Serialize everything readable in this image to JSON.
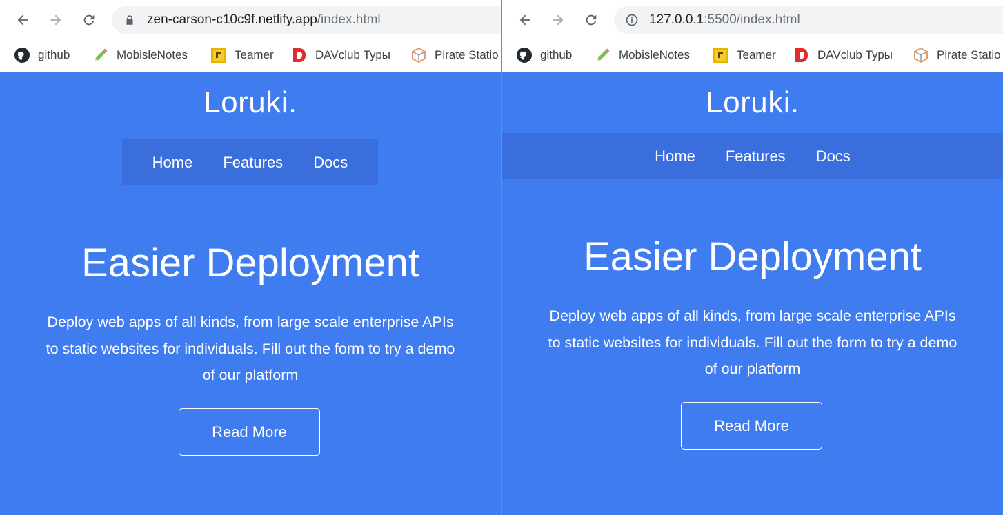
{
  "left": {
    "url_host": "zen-carson-c10c9f.netlify.app",
    "url_path": "/index.html",
    "secure_icon": "lock-icon"
  },
  "right": {
    "url_host": "127.0.0.1",
    "url_path": ":5500/index.html",
    "secure_icon": "info-icon"
  },
  "bookmarks": [
    {
      "label": "github",
      "icon": "github-icon"
    },
    {
      "label": "MobisleNotes",
      "icon": "pencil-icon"
    },
    {
      "label": "Teamer",
      "icon": "teamer-icon"
    },
    {
      "label": "DAVclub Туры",
      "icon": "davclub-icon"
    },
    {
      "label": "Pirate Statio",
      "icon": "pirate-station-icon"
    }
  ],
  "site": {
    "logo": "Loruki.",
    "nav": [
      "Home",
      "Features",
      "Docs"
    ],
    "hero_title": "Easier Deployment",
    "hero_text": "Deploy web apps of all kinds, from large scale enterprise APIs to static websites for individuals. Fill out the form to try a demo of our platform",
    "cta": "Read More"
  },
  "colors": {
    "page_bg": "#3f7cf0",
    "nav_bg": "#3a6edd",
    "omnibox_bg": "#f1f3f4"
  }
}
